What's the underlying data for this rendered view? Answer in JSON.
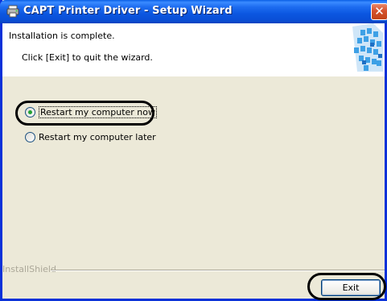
{
  "window": {
    "title": "CAPT Printer Driver - Setup Wizard",
    "close_glyph": "✕"
  },
  "header": {
    "line1": "Installation is complete.",
    "line2": "Click [Exit] to quit the wizard."
  },
  "options": [
    {
      "label": "Restart my computer now",
      "selected": true
    },
    {
      "label": "Restart my computer later",
      "selected": false
    }
  ],
  "footer": {
    "brand": "InstallShield",
    "exit_label": "Exit"
  },
  "colors": {
    "titlebar": "#0a5fe5",
    "dialog_bg": "#ece9d8",
    "radio_dot": "#22a234",
    "close_button": "#d6512d"
  },
  "icons": [
    "printer-app-icon",
    "close-icon",
    "header-graphic-icon"
  ]
}
